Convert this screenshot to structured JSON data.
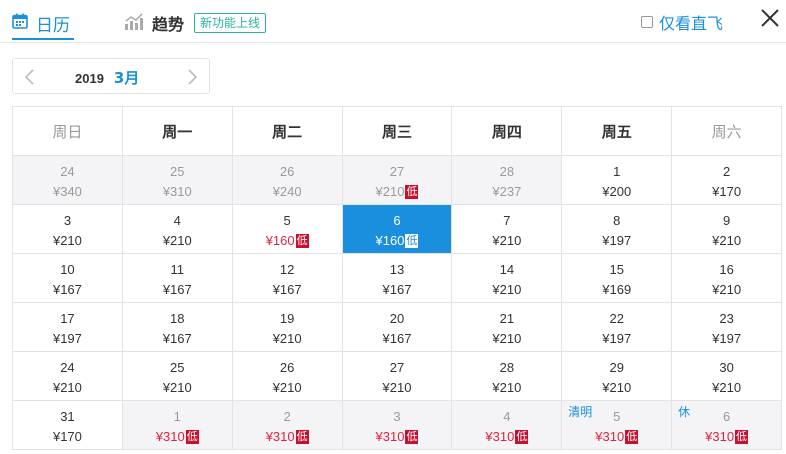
{
  "tabs": {
    "calendar_label": "日历",
    "trend_label": "趋势",
    "new_badge": "新功能上线"
  },
  "filter": {
    "direct_only_label": "仅看直飞",
    "direct_only_checked": false
  },
  "month_nav": {
    "year": "2019",
    "month": "3月"
  },
  "colors": {
    "accent": "#1a8fdd",
    "low_price": "#e5213f",
    "low_tag": "#c8102e",
    "badge": "#2bb3a0"
  },
  "icons": [
    "calendar-icon",
    "trend-chart-icon",
    "close-icon",
    "chevron-left-icon",
    "chevron-right-icon"
  ],
  "weekdays": [
    "周日",
    "周一",
    "周二",
    "周三",
    "周四",
    "周五",
    "周六"
  ],
  "low_label": "低",
  "weeks": [
    [
      {
        "day": "24",
        "price": "¥340",
        "state": "past"
      },
      {
        "day": "25",
        "price": "¥310",
        "state": "past"
      },
      {
        "day": "26",
        "price": "¥240",
        "state": "past"
      },
      {
        "day": "27",
        "price": "¥210",
        "state": "past",
        "low": true
      },
      {
        "day": "28",
        "price": "¥237",
        "state": "past"
      },
      {
        "day": "1",
        "price": "¥200"
      },
      {
        "day": "2",
        "price": "¥170"
      }
    ],
    [
      {
        "day": "3",
        "price": "¥210"
      },
      {
        "day": "4",
        "price": "¥210"
      },
      {
        "day": "5",
        "price": "¥160",
        "low": true
      },
      {
        "day": "6",
        "price": "¥160",
        "low": true,
        "state": "selected"
      },
      {
        "day": "7",
        "price": "¥210"
      },
      {
        "day": "8",
        "price": "¥197"
      },
      {
        "day": "9",
        "price": "¥210"
      }
    ],
    [
      {
        "day": "10",
        "price": "¥167"
      },
      {
        "day": "11",
        "price": "¥167"
      },
      {
        "day": "12",
        "price": "¥167"
      },
      {
        "day": "13",
        "price": "¥167"
      },
      {
        "day": "14",
        "price": "¥210"
      },
      {
        "day": "15",
        "price": "¥169"
      },
      {
        "day": "16",
        "price": "¥210"
      }
    ],
    [
      {
        "day": "17",
        "price": "¥197"
      },
      {
        "day": "18",
        "price": "¥167"
      },
      {
        "day": "19",
        "price": "¥210"
      },
      {
        "day": "20",
        "price": "¥167"
      },
      {
        "day": "21",
        "price": "¥210"
      },
      {
        "day": "22",
        "price": "¥197"
      },
      {
        "day": "23",
        "price": "¥197"
      }
    ],
    [
      {
        "day": "24",
        "price": "¥210"
      },
      {
        "day": "25",
        "price": "¥210"
      },
      {
        "day": "26",
        "price": "¥210"
      },
      {
        "day": "27",
        "price": "¥210"
      },
      {
        "day": "28",
        "price": "¥210"
      },
      {
        "day": "29",
        "price": "¥210"
      },
      {
        "day": "30",
        "price": "¥210"
      }
    ],
    [
      {
        "day": "31",
        "price": "¥170"
      },
      {
        "day": "1",
        "price": "¥310",
        "state": "other",
        "low": true
      },
      {
        "day": "2",
        "price": "¥310",
        "state": "other",
        "low": true
      },
      {
        "day": "3",
        "price": "¥310",
        "state": "other",
        "low": true
      },
      {
        "day": "4",
        "price": "¥310",
        "state": "other",
        "low": true
      },
      {
        "day": "5",
        "price": "¥310",
        "state": "other",
        "low": true,
        "holiday": "清明"
      },
      {
        "day": "6",
        "price": "¥310",
        "state": "other",
        "low": true,
        "holiday": "休"
      }
    ]
  ]
}
